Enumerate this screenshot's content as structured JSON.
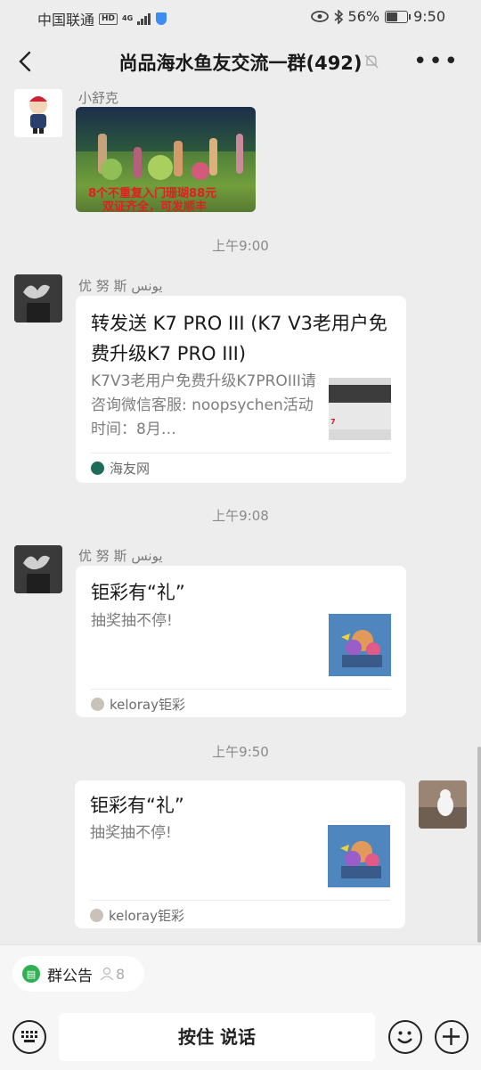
{
  "status_bar": {
    "carrier": "中国联通",
    "hd": "HD",
    "network": "4G",
    "battery_pct": "56%",
    "battery_level": 0.56,
    "time": "9:50"
  },
  "header": {
    "title": "尚品海水鱼友交流一群(492)"
  },
  "messages": [
    {
      "sender": "小舒克",
      "image_caption": [
        "8个不重复入门珊瑚88元",
        "双证齐全，可发顺丰"
      ]
    },
    {
      "time": "上午9:00",
      "sender": "优 努 斯  يونس",
      "card_title": "转发送 K7 PRO III (K7 V3老用户免费升级K7 PRO III)",
      "card_desc": "K7V3老用户免费升级K7PROIII请咨询微信客服: noopsychen活动时间：8月…",
      "card_source": "海友网"
    },
    {
      "time": "上午9:08",
      "sender": "优 努 斯  يونس",
      "card_title": "钜彩有“礼”",
      "card_desc": "抽奖抽不停!",
      "card_source": "keloray钜彩"
    },
    {
      "time": "上午9:50",
      "card_title": "钜彩有“礼”",
      "card_desc": "抽奖抽不停!",
      "card_source": "keloray钜彩"
    }
  ],
  "bottom_bar": {
    "notice_label": "群公告",
    "notice_count": "8",
    "voice_button": "按住 说话"
  }
}
